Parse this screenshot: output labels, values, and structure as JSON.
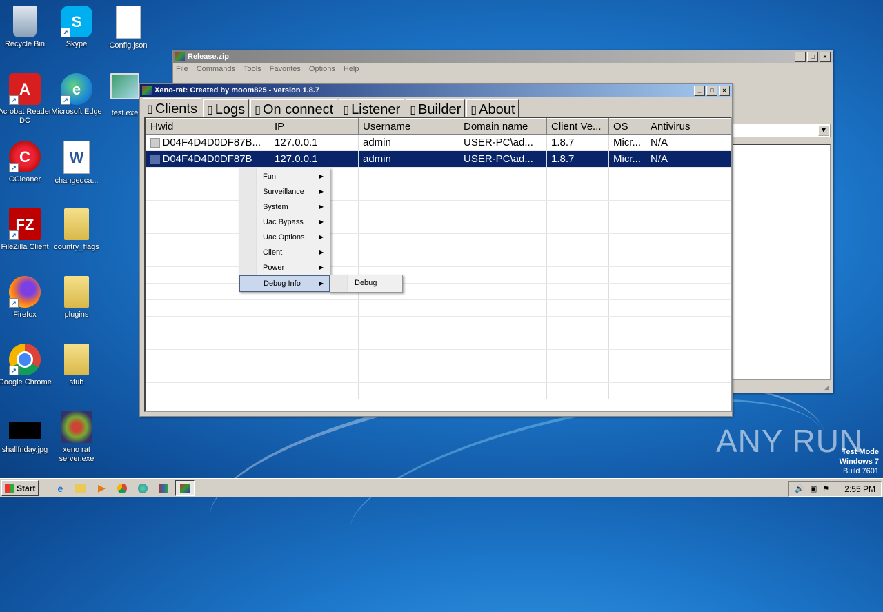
{
  "desktop": {
    "icons": [
      {
        "label": "Recycle Bin",
        "glyph": "🗑"
      },
      {
        "label": "Skype",
        "glyph": "S"
      },
      {
        "label": "Config.json",
        "glyph": ""
      },
      {
        "label": "Acrobat Reader DC",
        "glyph": "A"
      },
      {
        "label": "Microsoft Edge",
        "glyph": "e"
      },
      {
        "label": "test.exe",
        "glyph": ""
      },
      {
        "label": "CCleaner",
        "glyph": "C"
      },
      {
        "label": "changedca...",
        "glyph": "W"
      },
      {
        "label": "FileZilla Client",
        "glyph": "FZ"
      },
      {
        "label": "country_flags",
        "glyph": ""
      },
      {
        "label": "Firefox",
        "glyph": ""
      },
      {
        "label": "plugins",
        "glyph": ""
      },
      {
        "label": "Google Chrome",
        "glyph": ""
      },
      {
        "label": "stub",
        "glyph": ""
      },
      {
        "label": "shallfriday.jpg",
        "glyph": ""
      },
      {
        "label": "xeno rat server.exe",
        "glyph": ""
      }
    ]
  },
  "watermark": {
    "text": "ANY RUN"
  },
  "test_mode": {
    "line1": "Test Mode",
    "line2": "Windows 7",
    "line3": "Build 7601"
  },
  "release_window": {
    "title": "Release.zip",
    "menu": [
      "File",
      "Commands",
      "Tools",
      "Favorites",
      "Options",
      "Help"
    ]
  },
  "xeno_window": {
    "title": "Xeno-rat: Created by moom825 - version 1.8.7",
    "tabs": [
      {
        "glyph": "▯",
        "label": "Clients",
        "selected": true
      },
      {
        "glyph": "▯",
        "label": "Logs"
      },
      {
        "glyph": "▯",
        "label": "On connect"
      },
      {
        "glyph": "▯",
        "label": "Listener"
      },
      {
        "glyph": "▯",
        "label": "Builder"
      },
      {
        "glyph": "▯",
        "label": "About"
      }
    ],
    "columns": [
      "Hwid",
      "IP",
      "Username",
      "Domain name",
      "Client Ve...",
      "OS",
      "Antivirus"
    ],
    "rows": [
      [
        "D04F4D4D0DF87B...",
        "127.0.0.1",
        "admin",
        "USER-PC\\ad...",
        "1.8.7",
        "Micr...",
        "N/A"
      ],
      [
        "D04F4D4D0DF87B",
        "127.0.0.1",
        "admin",
        "USER-PC\\ad...",
        "1.8.7",
        "Micr...",
        "N/A"
      ]
    ],
    "selected_row": 1
  },
  "context_menu": {
    "items": [
      "Fun",
      "Surveillance",
      "System",
      "Uac Bypass",
      "Uac Options",
      "Client",
      "Power",
      "Debug Info"
    ],
    "highlighted": "Debug Info",
    "submenu": [
      "Debug"
    ]
  },
  "taskbar": {
    "start_label": "Start",
    "clock": "2:55 PM"
  }
}
